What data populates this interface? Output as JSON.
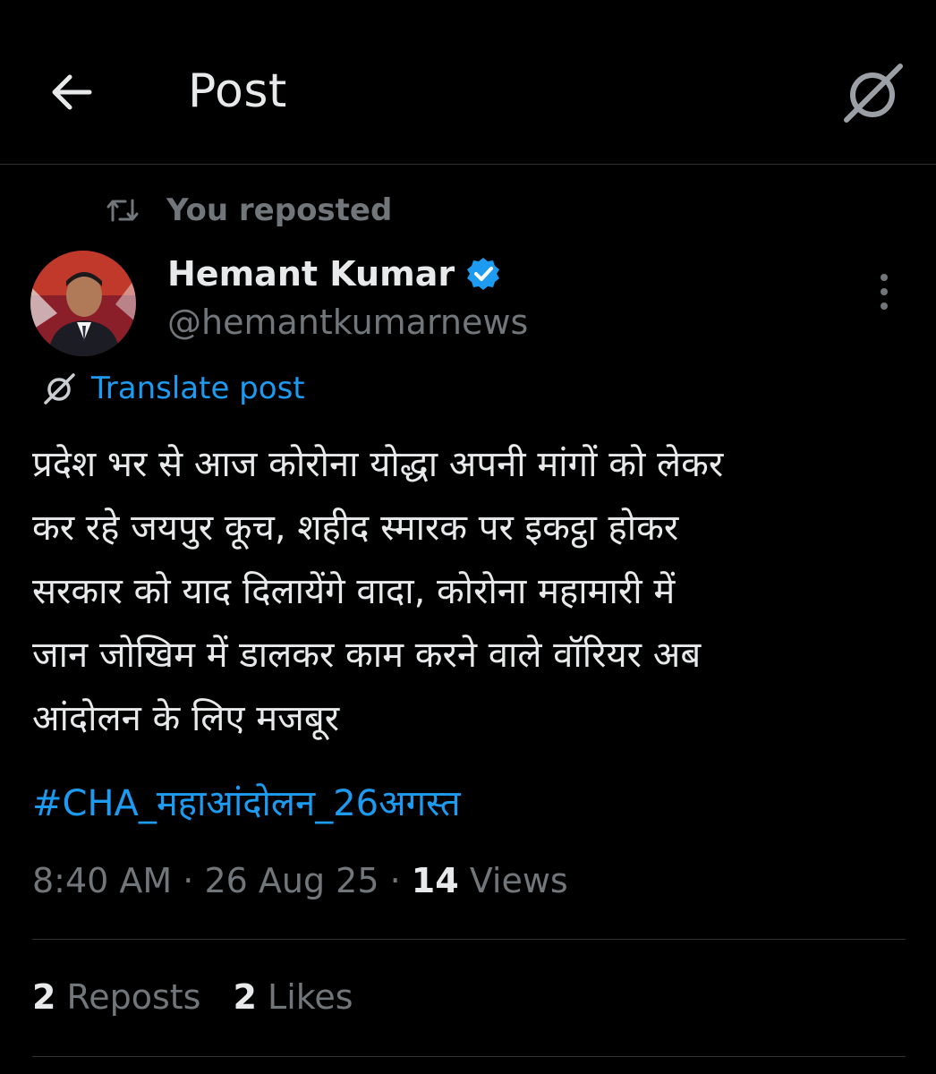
{
  "header": {
    "title": "Post",
    "back_icon": "arrow-left-icon",
    "grok_icon": "grok-icon"
  },
  "repost": {
    "icon": "repost-icon",
    "text": "You reposted"
  },
  "author": {
    "name": "Hemant Kumar",
    "handle": "@hemantkumarnews",
    "verified": true,
    "verified_color": "#1d9bf0"
  },
  "translate": {
    "label": "Translate post"
  },
  "post": {
    "lines": [
      "प्रदेश भर से आज कोरोना योद्धा अपनी मांगों को लेकर",
      "कर रहे जयपुर कूच, शहीद स्मारक पर इकट्ठा होकर",
      "सरकार को याद दिलायेंगे वादा, कोरोना महामारी में",
      "जान जोखिम में डालकर काम करने वाले वॉरियर अब",
      "आंदोलन के लिए मजबूर"
    ],
    "hashtag": "#CHA_महाआंदोलन_26अगस्त"
  },
  "meta": {
    "time": "8:40 AM",
    "sep1": " · ",
    "date": "26 Aug 25",
    "sep2": " · ",
    "views_count": "14",
    "views_label": " Views"
  },
  "stats": {
    "reposts_count": "2",
    "reposts_label": " Reposts",
    "likes_count": "2",
    "likes_label": " Likes"
  },
  "colors": {
    "background": "#000000",
    "accent": "#1d9bf0",
    "text": "#e7e9ea",
    "muted": "#71767b",
    "divider": "#2f3336"
  }
}
